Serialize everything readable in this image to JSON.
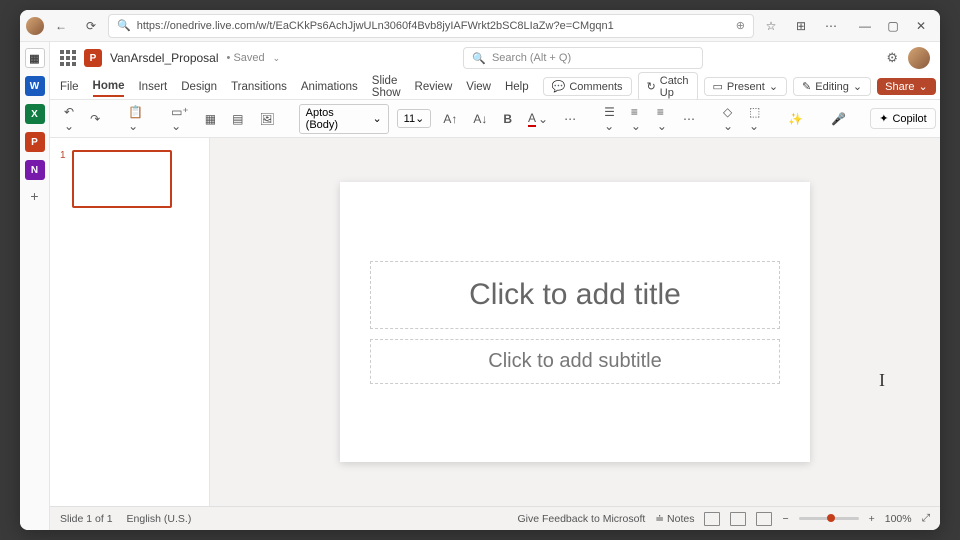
{
  "browser": {
    "url": "https://onedrive.live.com/w/t/EaCKkPs6AchJjwULn3060f4Bvb8jyIAFWrkt2bSC8LIaZw?e=CMgqn1"
  },
  "header": {
    "doc_name": "VanArsdel_Proposal",
    "saved_state": "Saved",
    "search_placeholder": "Search (Alt + Q)"
  },
  "tabs": {
    "file": "File",
    "home": "Home",
    "insert": "Insert",
    "design": "Design",
    "transitions": "Transitions",
    "animations": "Animations",
    "slideshow": "Slide Show",
    "review": "Review",
    "view": "View",
    "help": "Help"
  },
  "cmd": {
    "comments": "Comments",
    "catchup": "Catch Up",
    "present": "Present",
    "editing": "Editing",
    "share": "Share"
  },
  "ribbon": {
    "font_name": "Aptos (Body)",
    "font_size": "11",
    "copilot": "Copilot"
  },
  "slide": {
    "title_placeholder": "Click to add title",
    "subtitle_placeholder": "Click to add subtitle",
    "thumb_number": "1"
  },
  "status": {
    "slide_info": "Slide 1 of 1",
    "language": "English (U.S.)",
    "feedback": "Give Feedback to Microsoft",
    "notes": "Notes",
    "zoom": "100%"
  }
}
